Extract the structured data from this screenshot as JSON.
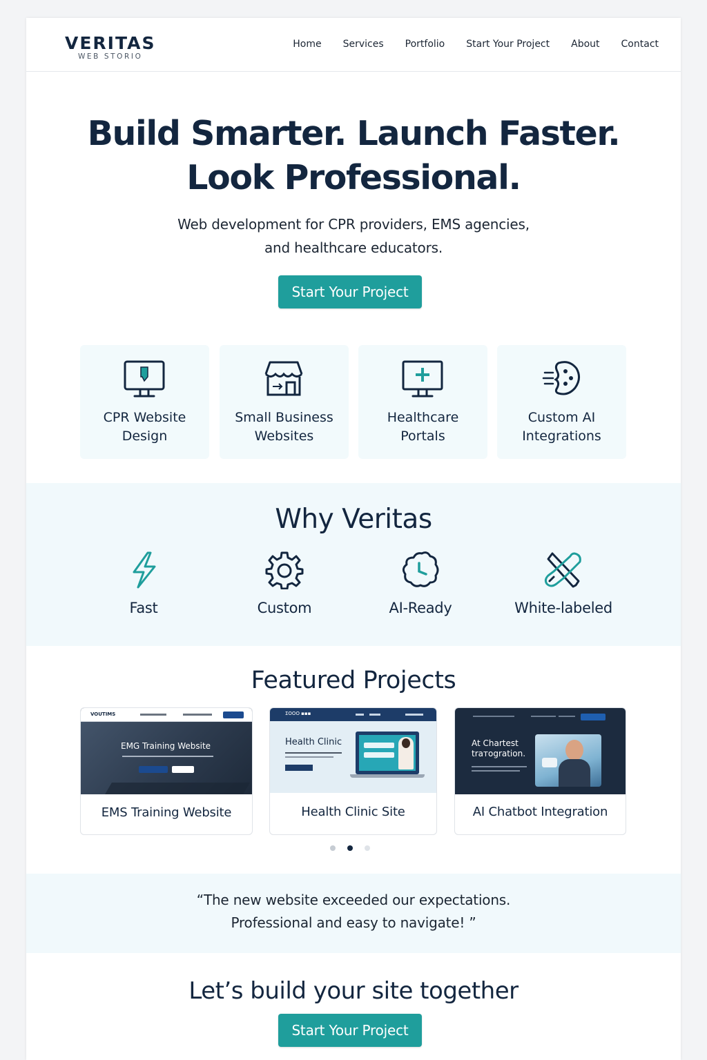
{
  "brand": {
    "name": "VERITAS",
    "tagline": "WEB STORIO"
  },
  "nav": {
    "items": [
      {
        "label": "Home"
      },
      {
        "label": "Services"
      },
      {
        "label": "Portfolio"
      },
      {
        "label": "Start Your Project"
      },
      {
        "label": "About"
      },
      {
        "label": "Contact"
      }
    ]
  },
  "hero": {
    "title_line1": "Build Smarter. Launch Faster.",
    "title_line2": "Look Professional.",
    "subtitle_line1": "Web development for CPR providers, EMS agencies,",
    "subtitle_line2": "and healthcare educators.",
    "cta_label": "Start Your Project"
  },
  "services": [
    {
      "line1": "CPR Website",
      "line2": "Design",
      "icon": "monitor-icon"
    },
    {
      "line1": "Small Business",
      "line2": "Websites",
      "icon": "storefront-icon"
    },
    {
      "line1": "Healthcare",
      "line2": "Portals",
      "icon": "medical-monitor-icon"
    },
    {
      "line1": "Custom AI",
      "line2": "Integrations",
      "icon": "ai-brain-icon"
    }
  ],
  "why": {
    "title": "Why Veritas",
    "features": [
      {
        "label": "Fast",
        "icon": "lightning-icon"
      },
      {
        "label": "Custom",
        "icon": "gear-icon"
      },
      {
        "label": "AI-Ready",
        "icon": "cloud-clock-icon"
      },
      {
        "label": "White-labeled",
        "icon": "tools-icon"
      }
    ]
  },
  "projects": {
    "title": "Featured Projects",
    "items": [
      {
        "label": "EMS Training Website",
        "thumb_logo": "VOUTIMS",
        "thumb_heading": "EMG Training Website",
        "thumb_button": "▪ ▪▪▪▪"
      },
      {
        "label": "Health Clinic Site",
        "thumb_logo": "ΣΟΟΟ ▪▪▪",
        "thumb_heading": "Health Clinic"
      },
      {
        "label": "AI Chatbot Integration",
        "thumb_heading_line1": "At Chartest",
        "thumb_heading_line2": "trатogration."
      }
    ],
    "carousel_active": 2,
    "carousel_count": 3
  },
  "testimonial": {
    "line1": "“The new website exceeded our expectations.",
    "line2": "Professional and easy to navigate! ”"
  },
  "cta": {
    "title": "Let’s build your site together",
    "button_label": "Start Your Project"
  },
  "colors": {
    "accent": "#1f9e9c",
    "navy": "#13263f",
    "section_tint": "#f1f9fc",
    "card_tint": "#f2fafc"
  }
}
